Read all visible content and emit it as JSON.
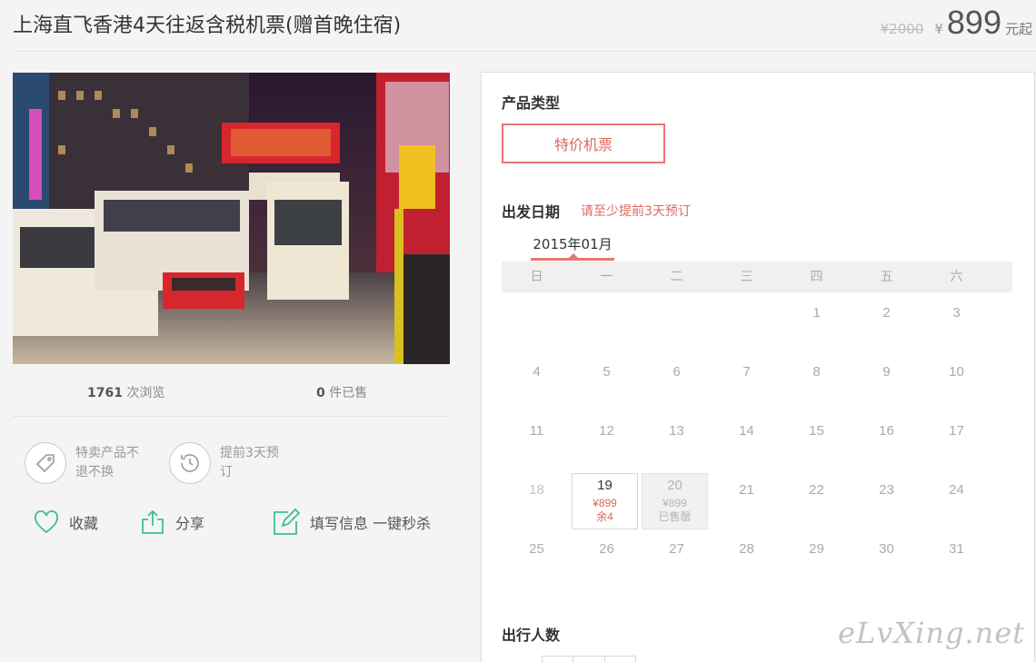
{
  "header": {
    "title": "上海直飞香港4天往返含税机票(赠首晚住宿)",
    "original_price": "¥2000",
    "currency": "¥",
    "price": "899",
    "price_suffix": "元起"
  },
  "stats": {
    "views": "1761",
    "views_label": " 次浏览",
    "sold": "0",
    "sold_label": " 件已售"
  },
  "notices": [
    {
      "icon": "tag-icon",
      "text": "特卖产品不退不换"
    },
    {
      "icon": "clock-icon",
      "text": "提前3天预订"
    }
  ],
  "actions": {
    "favorite": "收藏",
    "share": "分享",
    "fill_info": "填写信息 一键秒杀"
  },
  "booking": {
    "product_type_label": "产品类型",
    "product_type_option": "特价机票",
    "date_label": "出发日期",
    "date_hint": "请至少提前3天预订",
    "month": "2015年01月",
    "weekdays": [
      "日",
      "一",
      "二",
      "三",
      "四",
      "五",
      "六"
    ],
    "weeks": [
      [
        {
          "d": ""
        },
        {
          "d": ""
        },
        {
          "d": ""
        },
        {
          "d": ""
        },
        {
          "d": "1"
        },
        {
          "d": "2"
        },
        {
          "d": "3"
        }
      ],
      [
        {
          "d": "4"
        },
        {
          "d": "5"
        },
        {
          "d": "6"
        },
        {
          "d": "7"
        },
        {
          "d": "8"
        },
        {
          "d": "9"
        },
        {
          "d": "10"
        }
      ],
      [
        {
          "d": "11"
        },
        {
          "d": "12"
        },
        {
          "d": "13"
        },
        {
          "d": "14"
        },
        {
          "d": "15"
        },
        {
          "d": "16"
        },
        {
          "d": "17"
        }
      ],
      [
        {
          "d": "18",
          "past": true
        },
        {
          "d": "19",
          "status": "avail",
          "price": "¥899",
          "stock": "余4"
        },
        {
          "d": "20",
          "status": "soldout",
          "price": "¥899",
          "stock": "已售罄"
        },
        {
          "d": "21"
        },
        {
          "d": "22"
        },
        {
          "d": "23"
        },
        {
          "d": "24"
        }
      ],
      [
        {
          "d": "25"
        },
        {
          "d": "26"
        },
        {
          "d": "27"
        },
        {
          "d": "28"
        },
        {
          "d": "29"
        },
        {
          "d": "30"
        },
        {
          "d": "31"
        }
      ]
    ],
    "people_label": "出行人数"
  },
  "watermark": "eLvXing.net",
  "colors": {
    "accent": "#e8766a",
    "icon_green": "#3bbf9a",
    "background": "#f4f4f4"
  }
}
